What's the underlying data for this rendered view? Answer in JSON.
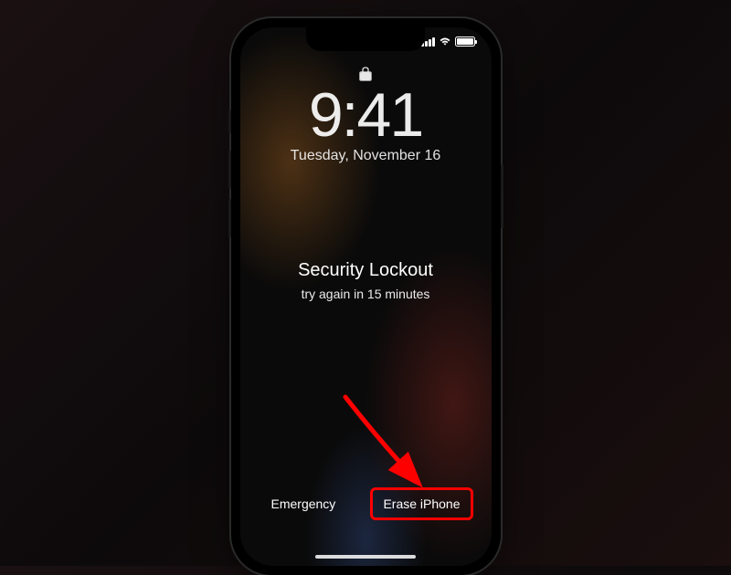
{
  "statusbar": {
    "signal_icon": "cellular-signal-icon",
    "wifi_icon": "wifi-icon",
    "battery_icon": "battery-icon"
  },
  "lock_icon": "lock-icon",
  "time": "9:41",
  "date": "Tuesday, November 16",
  "lockout": {
    "title": "Security Lockout",
    "subtitle": "try again in 15 minutes"
  },
  "buttons": {
    "emergency": "Emergency",
    "erase": "Erase iPhone"
  },
  "annotation": {
    "arrow_color": "#ff0000",
    "highlight_color": "#ff0000"
  }
}
